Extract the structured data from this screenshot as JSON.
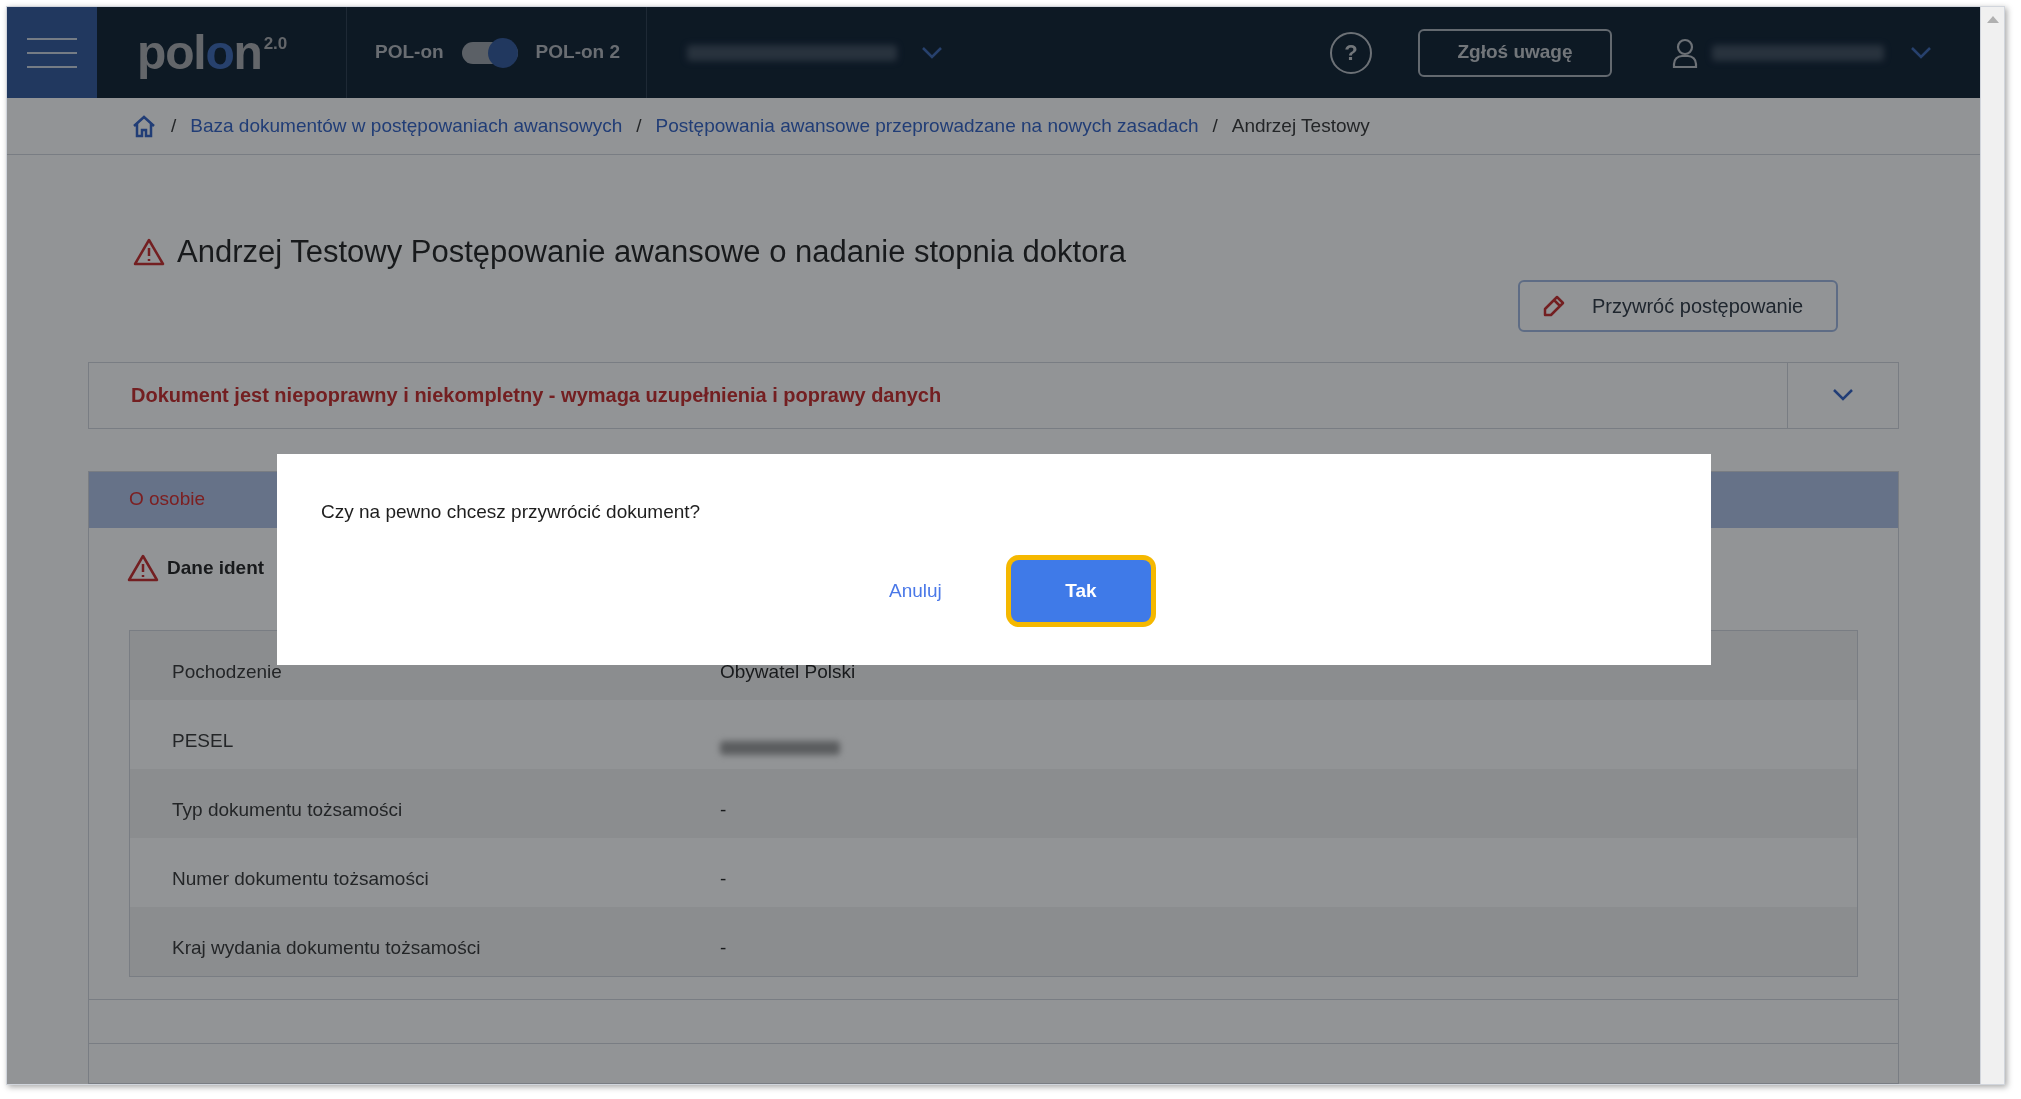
{
  "header": {
    "logo": "polon",
    "logo_version": "2.0",
    "switch_left": "POL-on",
    "switch": {
      "on": true
    },
    "switch_right": "POL-on 2",
    "report_button": "Zgłoś uwagę",
    "help": "?"
  },
  "breadcrumb": [
    {
      "separator": "/",
      "label": "Baza dokumentów w postępowaniach awansowych",
      "link": true
    },
    {
      "separator": "/",
      "label": "Postępowania awansowe przeprowadzane na nowych zasadach",
      "link": true
    },
    {
      "separator": "/",
      "label": "Andrzej Testowy",
      "link": false
    }
  ],
  "title": "Andrzej Testowy Postępowanie awansowe o nadanie stopnia doktora",
  "restore_button": "Przywróć postępowanie",
  "alert": {
    "text": "Dokument jest niepoprawny i niekompletny - wymaga uzupełnienia i poprawy danych",
    "expanded": false
  },
  "section": {
    "tab": "O osobie",
    "heading": "Dane ident",
    "rows": [
      {
        "label": "Pochodzenie",
        "value": "Obywatel Polski",
        "kind": "text"
      },
      {
        "label": "PESEL",
        "kind": "blurred"
      },
      {
        "label": "Typ dokumentu tożsamości",
        "value": "-",
        "kind": "text"
      },
      {
        "label": "Numer dokumentu tożsamości",
        "value": "-",
        "kind": "text"
      },
      {
        "label": "Kraj wydania dokumentu tożsamości",
        "value": "-",
        "kind": "text"
      }
    ]
  },
  "dialog": {
    "message": "Czy na pewno chcesz przywrócić dokument?",
    "cancel": "Anuluj",
    "confirm": "Tak",
    "confirm_focused": true
  }
}
